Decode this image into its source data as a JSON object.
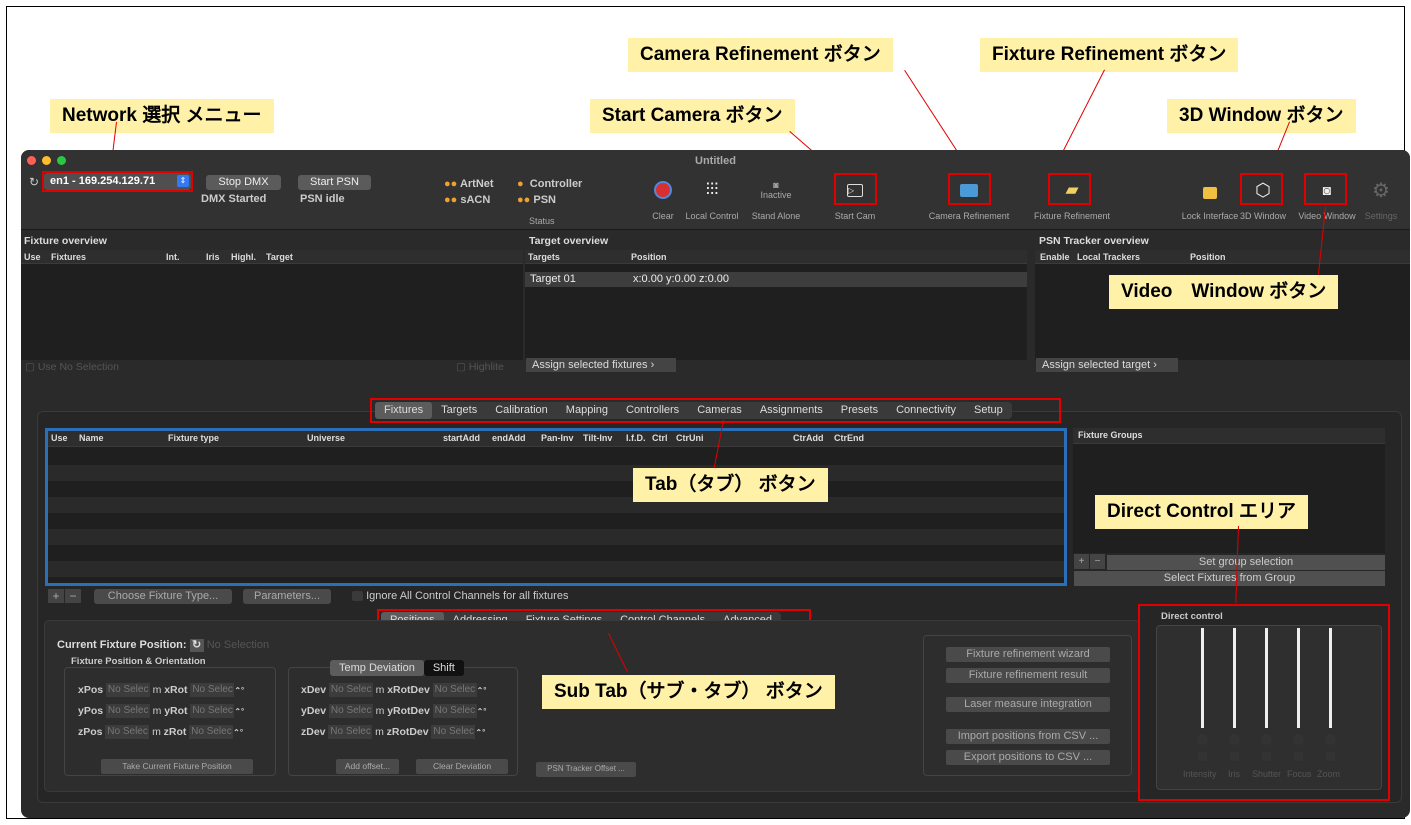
{
  "callouts": {
    "network": "Network 選択 メニュー",
    "camera_refinement": "Camera Refinement ボタン",
    "fixture_refinement": "Fixture Refinement ボタン",
    "start_camera": "Start Camera ボタン",
    "window_3d": "3D Window ボタン",
    "video_window": "Video　Window ボタン",
    "tab": "Tab（タブ） ボタン",
    "direct_control": "Direct Control エリア",
    "sub_tab": "Sub Tab（サブ・タブ） ボタン"
  },
  "window": {
    "title": "Untitled"
  },
  "toolbar": {
    "network_value": "en1 - 169.254.129.71",
    "stop_dmx": "Stop DMX",
    "dmx_status": "DMX Started",
    "start_psn": "Start PSN",
    "psn_status": "PSN idle",
    "artnet": "ArtNet",
    "sacn": "sACN",
    "controller": "Controller",
    "psn": "PSN",
    "status": "Status",
    "clear": "Clear",
    "local_control": "Local Control",
    "stand_alone": "Stand Alone",
    "inactive": "Inactive",
    "start_cam": "Start Cam",
    "camera_refinement": "Camera Refinement",
    "fixture_refinement": "Fixture Refinement",
    "lock_interface": "Lock Interface",
    "window_3d": "3D Window",
    "video_window": "Video Window",
    "settings": "Settings"
  },
  "fixture_overview": {
    "title": "Fixture overview",
    "columns": [
      "Use",
      "Fixtures",
      "Int.",
      "Iris",
      "Highl.",
      "Target"
    ],
    "use_label": "Use",
    "no_selection": "No Selection",
    "highlite": "Highlite"
  },
  "target_overview": {
    "title": "Target overview",
    "columns": [
      "Targets",
      "Position"
    ],
    "rows": [
      {
        "name": "Target 01",
        "position": "x:0.00 y:0.00 z:0.00"
      }
    ],
    "assign": "Assign selected fixtures"
  },
  "psn_overview": {
    "title": "PSN Tracker overview",
    "columns": [
      "Enable",
      "Local Trackers",
      "Position"
    ],
    "assign": "Assign selected target"
  },
  "main_tabs": [
    "Fixtures",
    "Targets",
    "Calibration",
    "Mapping",
    "Controllers",
    "Cameras",
    "Assignments",
    "Presets",
    "Connectivity",
    "Setup"
  ],
  "fixture_table": {
    "columns": [
      "Use",
      "Name",
      "Fixture type",
      "Universe",
      "startAdd",
      "endAdd",
      "Pan-Inv",
      "Tilt-Inv",
      "I.f.D.",
      "Ctrl",
      "CtrUni",
      "CtrAdd",
      "CtrEnd"
    ],
    "choose_type": "Choose Fixture Type...",
    "parameters": "Parameters...",
    "ignore_channels": "Ignore All Control Channels for all fixtures"
  },
  "groups": {
    "title": "Fixture Groups",
    "set_selection": "Set group selection",
    "select_from_group": "Select Fixtures from Group"
  },
  "sub_tabs": [
    "Positions",
    "Addressing",
    "Fixture Settings",
    "Control Channels",
    "Advanced"
  ],
  "position": {
    "current_label": "Current Fixture Position:",
    "no_selection": "No Selection",
    "orientation_title": "Fixture Position & Orientation",
    "field_value": "No Selec",
    "unit_m": "m",
    "rows": [
      {
        "pos": "xPos",
        "rot": "xRot"
      },
      {
        "pos": "yPos",
        "rot": "yRot"
      },
      {
        "pos": "zPos",
        "rot": "zRot"
      }
    ],
    "take_current": "Take Current Fixture Position"
  },
  "deviation": {
    "tab_temp": "Temp Deviation",
    "tab_shift": "Shift",
    "rows": [
      {
        "dev": "xDev",
        "rot": "xRotDev"
      },
      {
        "dev": "yDev",
        "rot": "yRotDev"
      },
      {
        "dev": "zDev",
        "rot": "zRotDev"
      }
    ],
    "add_offset": "Add offset...",
    "clear_deviation": "Clear Deviation",
    "psn_offset": "PSN Tracker Offset ..."
  },
  "refine_buttons": {
    "wizard": "Fixture refinement wizard",
    "result": "Fixture refinement result",
    "laser": "Laser measure integration",
    "import_csv": "Import positions from CSV ...",
    "export_csv": "Export positions to CSV ..."
  },
  "direct_control": {
    "title": "Direct control",
    "channels": [
      "Intensity",
      "Iris",
      "Shutter",
      "Focus",
      "Zoom"
    ]
  },
  "colors": {
    "accent_red": "#e00000",
    "callout_bg": "#fff2a8",
    "table_border": "#2a6fb8"
  }
}
